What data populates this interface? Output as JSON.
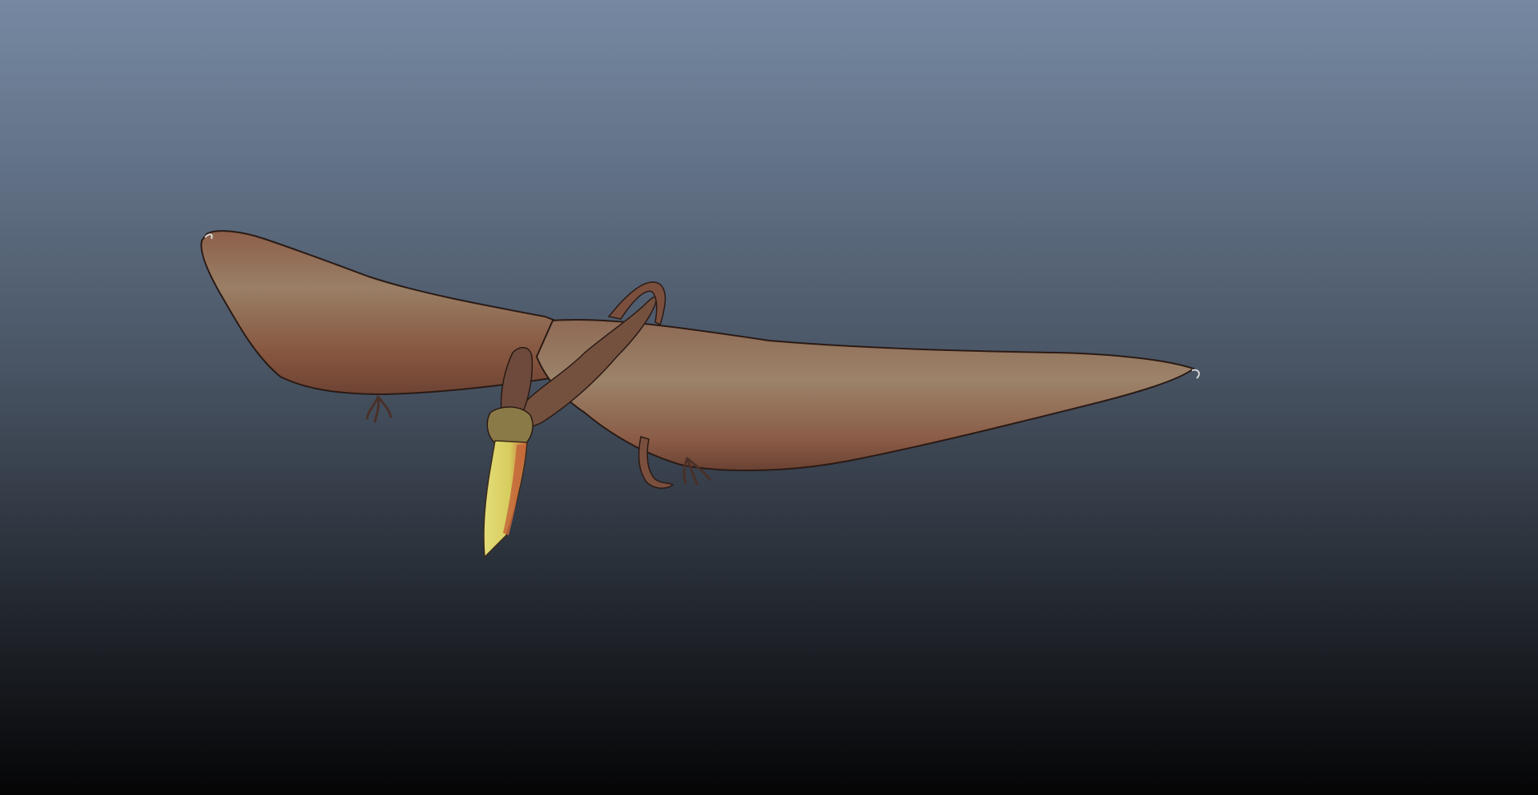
{
  "viewport": {
    "background_gradient": {
      "top": "#7689a2",
      "mid": "#4a5666",
      "bottom": "#050506"
    }
  },
  "model": {
    "icon": "pterosaur-3d-model",
    "colors": {
      "wing_base": "#8a5c48",
      "wing_light": "#9c8268",
      "wing_dark": "#6e4436",
      "edge": "#2a1a14",
      "body": "#74503f",
      "beak_yellow": "#dcd46a",
      "beak_orange": "#c46a3a",
      "claw": "#4a3028"
    }
  }
}
